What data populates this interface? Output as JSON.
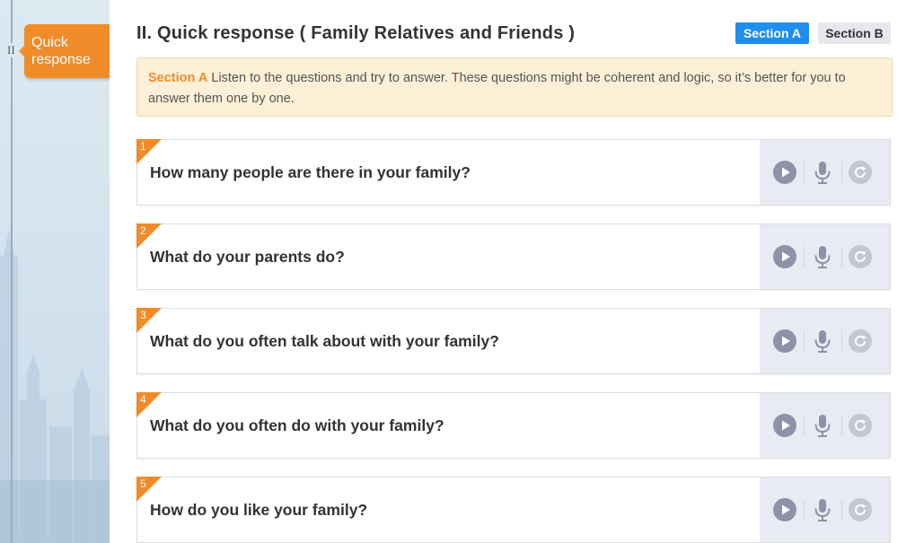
{
  "sidebar": {
    "roman": "II",
    "active_tab": "Quick response"
  },
  "header": {
    "title": "II. Quick response ( Family Relatives and Friends )",
    "section_a": "Section A",
    "section_b": "Section B"
  },
  "instruction": {
    "label": "Section A",
    "text": " Listen to the questions and try to answer. These questions might be coherent and logic, so it’s better for you to answer them one by one."
  },
  "colors": {
    "accent": "#f08b2a",
    "primary": "#1e8ff0",
    "icon": "#8c93a8"
  },
  "questions": [
    {
      "num": "1",
      "text": "How many people are there in your family?"
    },
    {
      "num": "2",
      "text": "What do your parents do?"
    },
    {
      "num": "3",
      "text": "What do you often talk about with your family?"
    },
    {
      "num": "4",
      "text": "What do you often do with your family?"
    },
    {
      "num": "5",
      "text": "How do you like your family?"
    }
  ],
  "controls": {
    "play": "play-icon",
    "record": "microphone-icon",
    "redo": "refresh-icon"
  }
}
